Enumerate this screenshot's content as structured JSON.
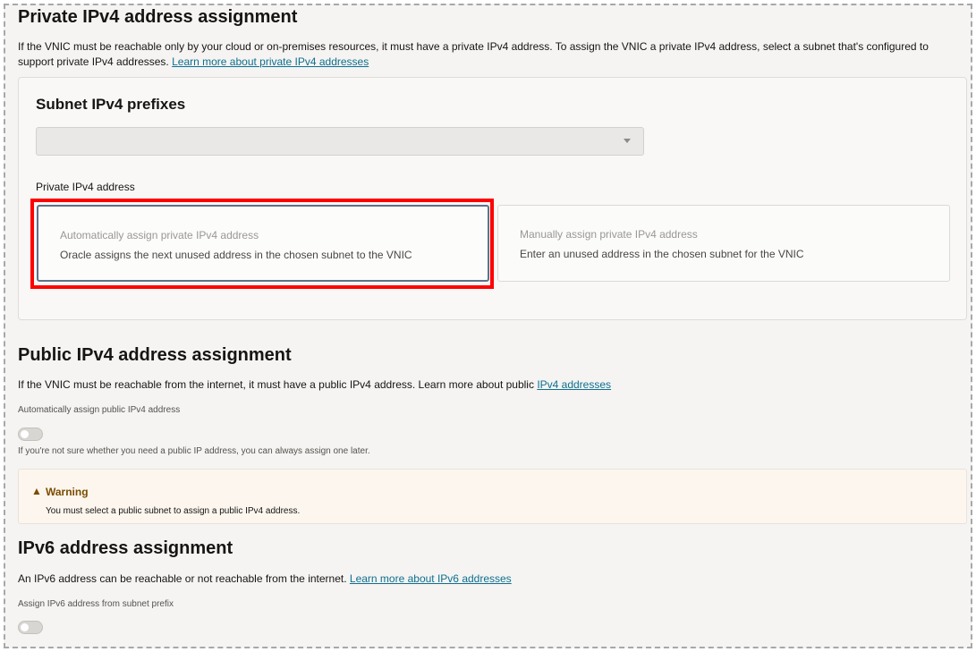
{
  "private": {
    "heading": "Private IPv4 address assignment",
    "desc_text": "If the VNIC must be reachable only by your cloud or on-premises resources, it must have a private IPv4 address. To assign the VNIC a private IPv4 address, select a subnet that's configured to support private IPv4 addresses.",
    "link": "Learn more about private IPv4 addresses",
    "card": {
      "title": "Subnet IPv4 prefixes",
      "select_value": "",
      "field_label": "Private IPv4 address",
      "options": [
        {
          "title": "Automatically assign private IPv4 address",
          "desc": "Oracle assigns the next unused address in the chosen subnet to the VNIC"
        },
        {
          "title": "Manually assign private IPv4 address",
          "desc": "Enter an unused address in the chosen subnet for the VNIC"
        }
      ]
    }
  },
  "public": {
    "heading": "Public IPv4 address assignment",
    "desc_text": "If the VNIC must be reachable from the internet, it must have a public IPv4 address. Learn more about public",
    "link": "IPv4 addresses",
    "toggle_label": "Automatically assign public IPv4 address",
    "toggle_on": false,
    "hint": "If you're not sure whether you need a public IP address, you can always assign one later.",
    "warning": {
      "icon": "warning-triangle-icon",
      "glyph": "▲",
      "title": "Warning",
      "text": "You must select a public subnet to assign a public IPv4 address."
    }
  },
  "ipv6": {
    "heading": "IPv6 address assignment",
    "desc_text": "An IPv6 address can be reachable or not reachable from the internet.",
    "link": "Learn more about IPv6 addresses",
    "toggle_label": "Assign IPv6 address from subnet prefix",
    "toggle_on": false
  },
  "colors": {
    "highlight": "#ff0000",
    "link": "#0e6f8f",
    "warning_text": "#7a4d00"
  }
}
